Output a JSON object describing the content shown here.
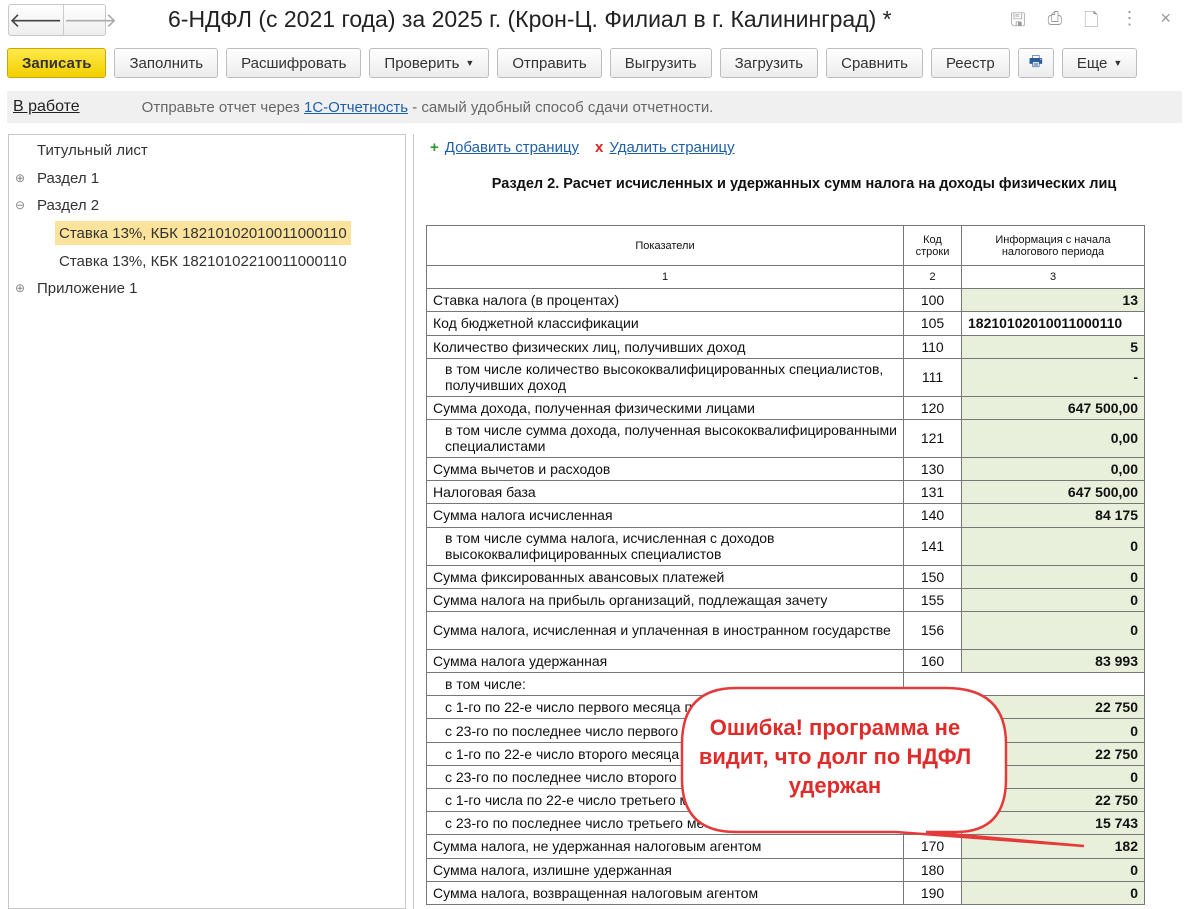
{
  "window": {
    "title": "6-НДФЛ (с 2021 года) за 2025 г. (Крон-Ц. Филиал в г. Калининград) *",
    "back": "🡐",
    "forward": "🡒",
    "icons": [
      "save-icon",
      "print-icon",
      "preview-icon",
      "more-icon",
      "close-icon"
    ]
  },
  "toolbar": {
    "save": "Записать",
    "fill": "Заполнить",
    "decode": "Расшифровать",
    "check": "Проверить",
    "send": "Отправить",
    "export": "Выгрузить",
    "import": "Загрузить",
    "compare": "Сравнить",
    "registry": "Реестр",
    "more": "Еще"
  },
  "infobar": {
    "status": "В работе",
    "hint_pre": "Отправьте отчет через ",
    "hint_link": "1С-Отчетность",
    "hint_post": " - самый удобный способ сдачи отчетности."
  },
  "tree": [
    "Титульный лист",
    "Раздел 1",
    "Раздел 2",
    "Ставка 13%, КБК 18210102010011000110",
    "Ставка 13%, КБК 18210102210011000110",
    "Приложение 1"
  ],
  "page_actions": {
    "add": "Добавить страницу",
    "delete": "Удалить страницу"
  },
  "section": {
    "title": "Раздел 2. Расчет исчисленных и удержанных сумм налога на доходы физических лиц",
    "headers": [
      "Показатели",
      "Код строки",
      "Информация с начала налогового периода"
    ],
    "col_numbers": [
      "1",
      "2",
      "3"
    ],
    "rows": [
      {
        "label": "Ставка налога (в процентах)",
        "code": "100",
        "value": "13"
      },
      {
        "label": "Код бюджетной классификации",
        "code": "105",
        "value": "18210102010011000110"
      },
      {
        "label": "Количество физических лиц, получивших доход",
        "code": "110",
        "value": "5"
      },
      {
        "label": "в том числе количество высококвалифицированных специалистов, получивших доход",
        "code": "111",
        "value": "-"
      },
      {
        "label": "Сумма дохода, полученная физическими лицами",
        "code": "120",
        "value": "647 500,00"
      },
      {
        "label": "в том числе сумма дохода, полученная высококвалифицированными специалистами",
        "code": "121",
        "value": "0,00"
      },
      {
        "label": "Сумма вычетов и расходов",
        "code": "130",
        "value": "0,00"
      },
      {
        "label": "Налоговая база",
        "code": "131",
        "value": "647 500,00"
      },
      {
        "label": "Сумма налога исчисленная",
        "code": "140",
        "value": "84 175"
      },
      {
        "label": "в том числе сумма налога, исчисленная с доходов высококвалифицированных специалистов",
        "code": "141",
        "value": "0"
      },
      {
        "label": "Сумма фиксированных авансовых платежей",
        "code": "150",
        "value": "0"
      },
      {
        "label": "Сумма налога на прибыль организаций, подлежащая зачету",
        "code": "155",
        "value": "0"
      },
      {
        "label": "Сумма налога, исчисленная и уплаченная в иностранном государстве",
        "code": "156",
        "value": "0"
      },
      {
        "label": "Сумма налога удержанная",
        "code": "160",
        "value": "83 993"
      },
      {
        "label": "в том числе:",
        "code": "",
        "value": ""
      },
      {
        "label": "с 1-го по 22-е число первого месяца последнего квартала",
        "code": "",
        "value": "22 750"
      },
      {
        "label": "с 23-го по последнее число первого месяца последнего квартала",
        "code": "",
        "value": "0"
      },
      {
        "label": "с 1-го по 22-е число второго месяца последнего квартала",
        "code": "",
        "value": "22 750"
      },
      {
        "label": "с 23-го по последнее число второго месяца последнего квартала",
        "code": "",
        "value": "0"
      },
      {
        "label": "с 1-го числа по 22-е число третьего месяца последнего квартала",
        "code": "",
        "value": "22 750"
      },
      {
        "label": "с 23-го по последнее число третьего месяца последнего квартала",
        "code": "",
        "value": "15 743"
      },
      {
        "label": "Сумма налога, не удержанная налоговым агентом",
        "code": "170",
        "value": "182"
      },
      {
        "label": "Сумма налога, излишне удержанная",
        "code": "180",
        "value": "0"
      },
      {
        "label": "Сумма налога, возвращенная налоговым агентом",
        "code": "190",
        "value": "0"
      }
    ]
  },
  "callout": {
    "text": "Ошибка! программа не видит, что долг по НДФЛ удержан",
    "color": "#e02b2b"
  }
}
